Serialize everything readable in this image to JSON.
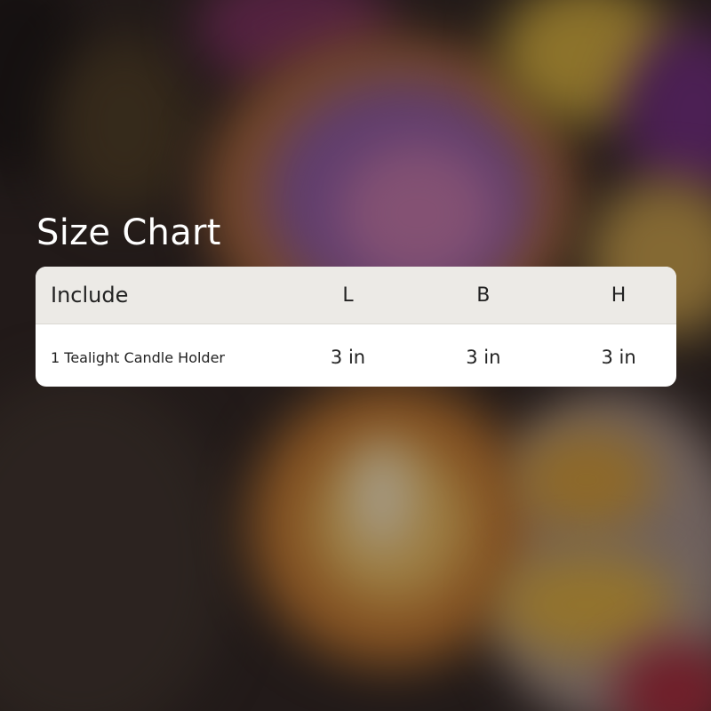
{
  "title": "Size Chart",
  "table": {
    "headers": [
      "Include",
      "L",
      "B",
      "H"
    ],
    "rows": [
      [
        "1 Tealight Candle Holder",
        "3 in",
        "3 in",
        "3 in"
      ]
    ]
  }
}
